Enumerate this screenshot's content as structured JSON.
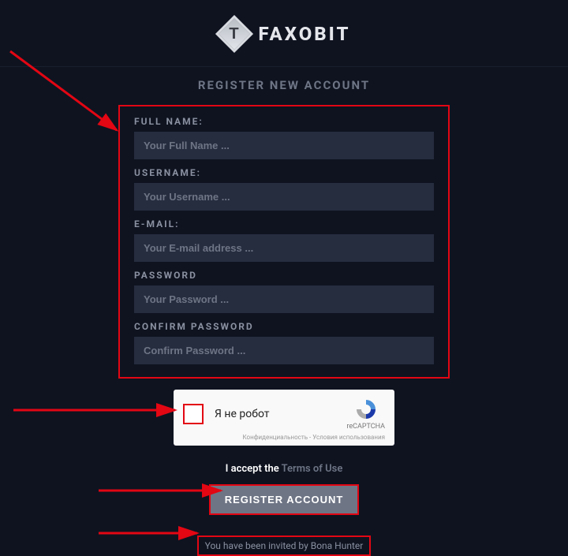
{
  "brand": {
    "name": "FAXOBIT",
    "mark": "T"
  },
  "page_title": "REGISTER NEW ACCOUNT",
  "fields": {
    "fullname": {
      "label": "FULL NAME:",
      "placeholder": "Your Full Name ..."
    },
    "username": {
      "label": "USERNAME:",
      "placeholder": "Your Username ..."
    },
    "email": {
      "label": "E-MAIL:",
      "placeholder": "Your E-mail address ..."
    },
    "password": {
      "label": "PASSWORD",
      "placeholder": "Your Password ..."
    },
    "confirm": {
      "label": "CONFIRM PASSWORD",
      "placeholder": "Confirm Password ..."
    }
  },
  "recaptcha": {
    "label": "Я не робот",
    "brand": "reCAPTCHA",
    "footer": "Конфиденциальность - Условия использования"
  },
  "accept": {
    "prefix": "I accept the ",
    "link": "Terms of Use"
  },
  "register_button": "REGISTER ACCOUNT",
  "invited_text": "You have been invited by Bona Hunter",
  "colors": {
    "accent_red": "#e30613"
  }
}
